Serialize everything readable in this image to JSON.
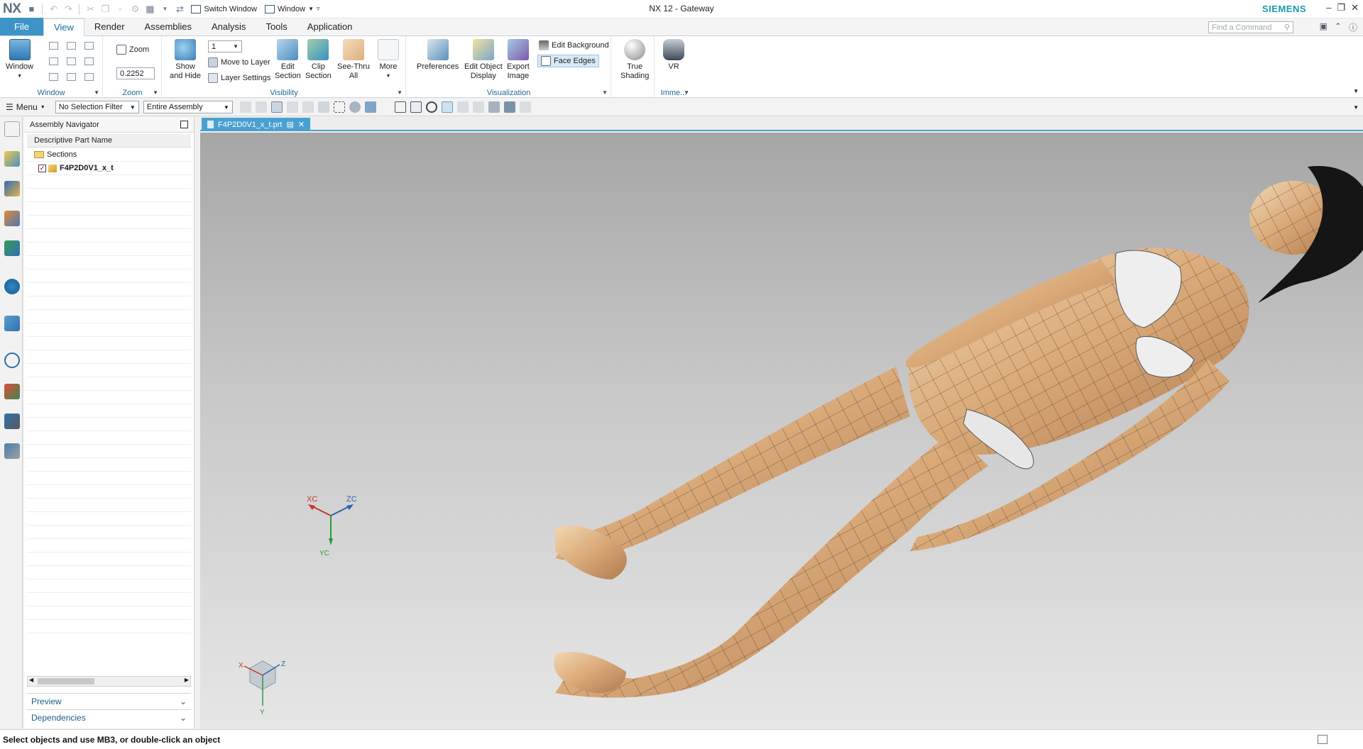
{
  "app": {
    "logo": "NX",
    "title": "NX 12 - Gateway",
    "brand": "SIEMENS",
    "switch_window": "Switch Window",
    "window_menu": "Window"
  },
  "tabs": [
    {
      "label": "File"
    },
    {
      "label": "View"
    },
    {
      "label": "Render"
    },
    {
      "label": "Assemblies"
    },
    {
      "label": "Analysis"
    },
    {
      "label": "Tools"
    },
    {
      "label": "Application"
    }
  ],
  "find_command": {
    "placeholder": "Find a Command"
  },
  "ribbon": {
    "window_group": {
      "button": "Window",
      "label": "Window"
    },
    "zoom_group": {
      "button": "Zoom",
      "value": "0.2252",
      "label": "Zoom"
    },
    "visibility_group": {
      "layer_value": "1",
      "show_hide": "Show\nand Hide",
      "move_to_layer": "Move to Layer",
      "layer_settings": "Layer Settings",
      "edit_section": "Edit\nSection",
      "clip_section": "Clip\nSection",
      "see_thru": "See-Thru\nAll",
      "more": "More",
      "label": "Visibility"
    },
    "visualization_group": {
      "preferences": "Preferences",
      "edit_object_display": "Edit Object\nDisplay",
      "export_image": "Export\nImage",
      "edit_background": "Edit Background",
      "face_edges": "Face Edges",
      "label": "Visualization"
    },
    "shading_group": {
      "true_shading": "True\nShading"
    },
    "immersive_group": {
      "vr": "VR",
      "label": "Imme..."
    }
  },
  "command_bar": {
    "menu": "Menu",
    "selection_filter": "No Selection Filter",
    "scope": "Entire Assembly"
  },
  "navigator": {
    "title": "Assembly Navigator",
    "column": "Descriptive Part Name",
    "rows": [
      {
        "label": "Sections"
      },
      {
        "label": "F4P2D0V1_x_t"
      }
    ],
    "preview": "Preview",
    "dependencies": "Dependencies"
  },
  "viewport": {
    "tab_label": "F4P2D0V1_x_t.prt",
    "triad": {
      "x": "XC",
      "z": "ZC",
      "y": "YC"
    },
    "view_triad": {
      "x": "X",
      "y": "Y",
      "z": "Z"
    }
  },
  "status": {
    "message": "Select objects and use MB3, or double-click an object"
  },
  "colors": {
    "accent": "#3d94c6",
    "brand": "#1a9bb0",
    "label": "#1f6d96",
    "skin": "#dcb088"
  }
}
